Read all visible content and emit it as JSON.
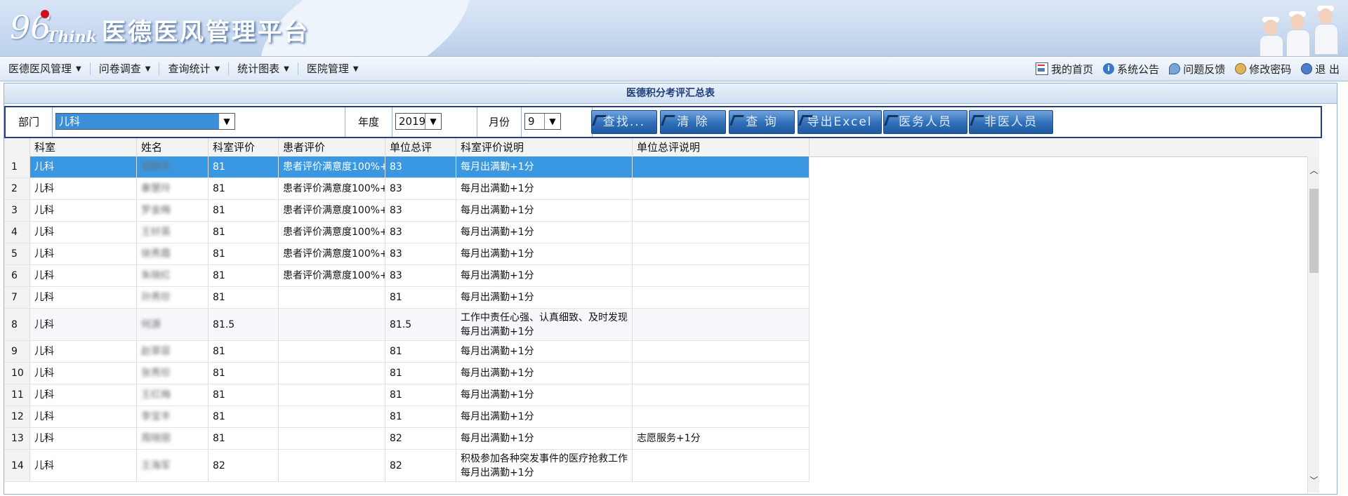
{
  "header": {
    "logo_mark": "96",
    "logo_text": "Think",
    "title": "医德医风管理平台"
  },
  "menu": {
    "left": [
      {
        "label": "医德医风管理"
      },
      {
        "label": "问卷调查"
      },
      {
        "label": "查询统计"
      },
      {
        "label": "统计图表"
      },
      {
        "label": "医院管理"
      }
    ],
    "right": [
      {
        "label": "我的首页",
        "icon": "home-icon"
      },
      {
        "label": "系统公告",
        "icon": "info-icon"
      },
      {
        "label": "问题反馈",
        "icon": "feedback-icon"
      },
      {
        "label": "修改密码",
        "icon": "password-icon"
      },
      {
        "label": "退 出",
        "icon": "logout-icon"
      }
    ]
  },
  "panel": {
    "title": "医德积分考评汇总表"
  },
  "filter": {
    "dept_label": "部门",
    "dept_value": "儿科",
    "year_label": "年度",
    "year_value": "2019",
    "month_label": "月份",
    "month_value": "9",
    "buttons": {
      "find": "查找...",
      "clear": "清 除",
      "query": "查 询",
      "export": "导出Excel",
      "medical_staff": "医务人员",
      "non_medical_staff": "非医人员"
    }
  },
  "table": {
    "columns": [
      "科室",
      "姓名",
      "科室评价",
      "患者评价",
      "单位总评",
      "科室评价说明",
      "单位总评说明"
    ],
    "rows": [
      {
        "no": "1",
        "dept": "儿科",
        "name": "胡丽芳",
        "dept_eval": "81",
        "patient_eval": "患者评价满意度100%+",
        "total": "83",
        "dept_note": "每月出满勤+1分",
        "dept_note2": "",
        "total_note": ""
      },
      {
        "no": "2",
        "dept": "儿科",
        "name": "秦慧玲",
        "dept_eval": "81",
        "patient_eval": "患者评价满意度100%+",
        "total": "83",
        "dept_note": "每月出满勤+1分",
        "dept_note2": "",
        "total_note": ""
      },
      {
        "no": "3",
        "dept": "儿科",
        "name": "罗金梅",
        "dept_eval": "81",
        "patient_eval": "患者评价满意度100%+",
        "total": "83",
        "dept_note": "每月出满勤+1分",
        "dept_note2": "",
        "total_note": ""
      },
      {
        "no": "4",
        "dept": "儿科",
        "name": "王好英",
        "dept_eval": "81",
        "patient_eval": "患者评价满意度100%+",
        "total": "83",
        "dept_note": "每月出满勤+1分",
        "dept_note2": "",
        "total_note": ""
      },
      {
        "no": "5",
        "dept": "儿科",
        "name": "徐秀霞",
        "dept_eval": "81",
        "patient_eval": "患者评价满意度100%+",
        "total": "83",
        "dept_note": "每月出满勤+1分",
        "dept_note2": "",
        "total_note": ""
      },
      {
        "no": "6",
        "dept": "儿科",
        "name": "朱晓红",
        "dept_eval": "81",
        "patient_eval": "患者评价满意度100%+",
        "total": "83",
        "dept_note": "每月出满勤+1分",
        "dept_note2": "",
        "total_note": ""
      },
      {
        "no": "7",
        "dept": "儿科",
        "name": "孙秀珍",
        "dept_eval": "81",
        "patient_eval": "",
        "total": "81",
        "dept_note": "每月出满勤+1分",
        "dept_note2": "",
        "total_note": ""
      },
      {
        "no": "8",
        "dept": "儿科",
        "name": "何源",
        "dept_eval": "81.5",
        "patient_eval": "",
        "total": "81.5",
        "dept_note": "工作中责任心强、认真细致、及时发现",
        "dept_note2": "每月出满勤+1分",
        "total_note": ""
      },
      {
        "no": "9",
        "dept": "儿科",
        "name": "赵翠容",
        "dept_eval": "81",
        "patient_eval": "",
        "total": "81",
        "dept_note": "每月出满勤+1分",
        "dept_note2": "",
        "total_note": ""
      },
      {
        "no": "10",
        "dept": "儿科",
        "name": "张秀珍",
        "dept_eval": "81",
        "patient_eval": "",
        "total": "81",
        "dept_note": "每月出满勤+1分",
        "dept_note2": "",
        "total_note": ""
      },
      {
        "no": "11",
        "dept": "儿科",
        "name": "王红梅",
        "dept_eval": "81",
        "patient_eval": "",
        "total": "81",
        "dept_note": "每月出满勤+1分",
        "dept_note2": "",
        "total_note": ""
      },
      {
        "no": "12",
        "dept": "儿科",
        "name": "李宝丰",
        "dept_eval": "81",
        "patient_eval": "",
        "total": "81",
        "dept_note": "每月出满勤+1分",
        "dept_note2": "",
        "total_note": ""
      },
      {
        "no": "13",
        "dept": "儿科",
        "name": "周晓丽",
        "dept_eval": "81",
        "patient_eval": "",
        "total": "82",
        "dept_note": "每月出满勤+1分",
        "dept_note2": "",
        "total_note": "志愿服务+1分"
      },
      {
        "no": "14",
        "dept": "儿科",
        "name": "王海军",
        "dept_eval": "82",
        "patient_eval": "",
        "total": "82",
        "dept_note": "积极参加各种突发事件的医疗抢救工作",
        "dept_note2": "每月出满勤+1分",
        "total_note": ""
      }
    ]
  }
}
